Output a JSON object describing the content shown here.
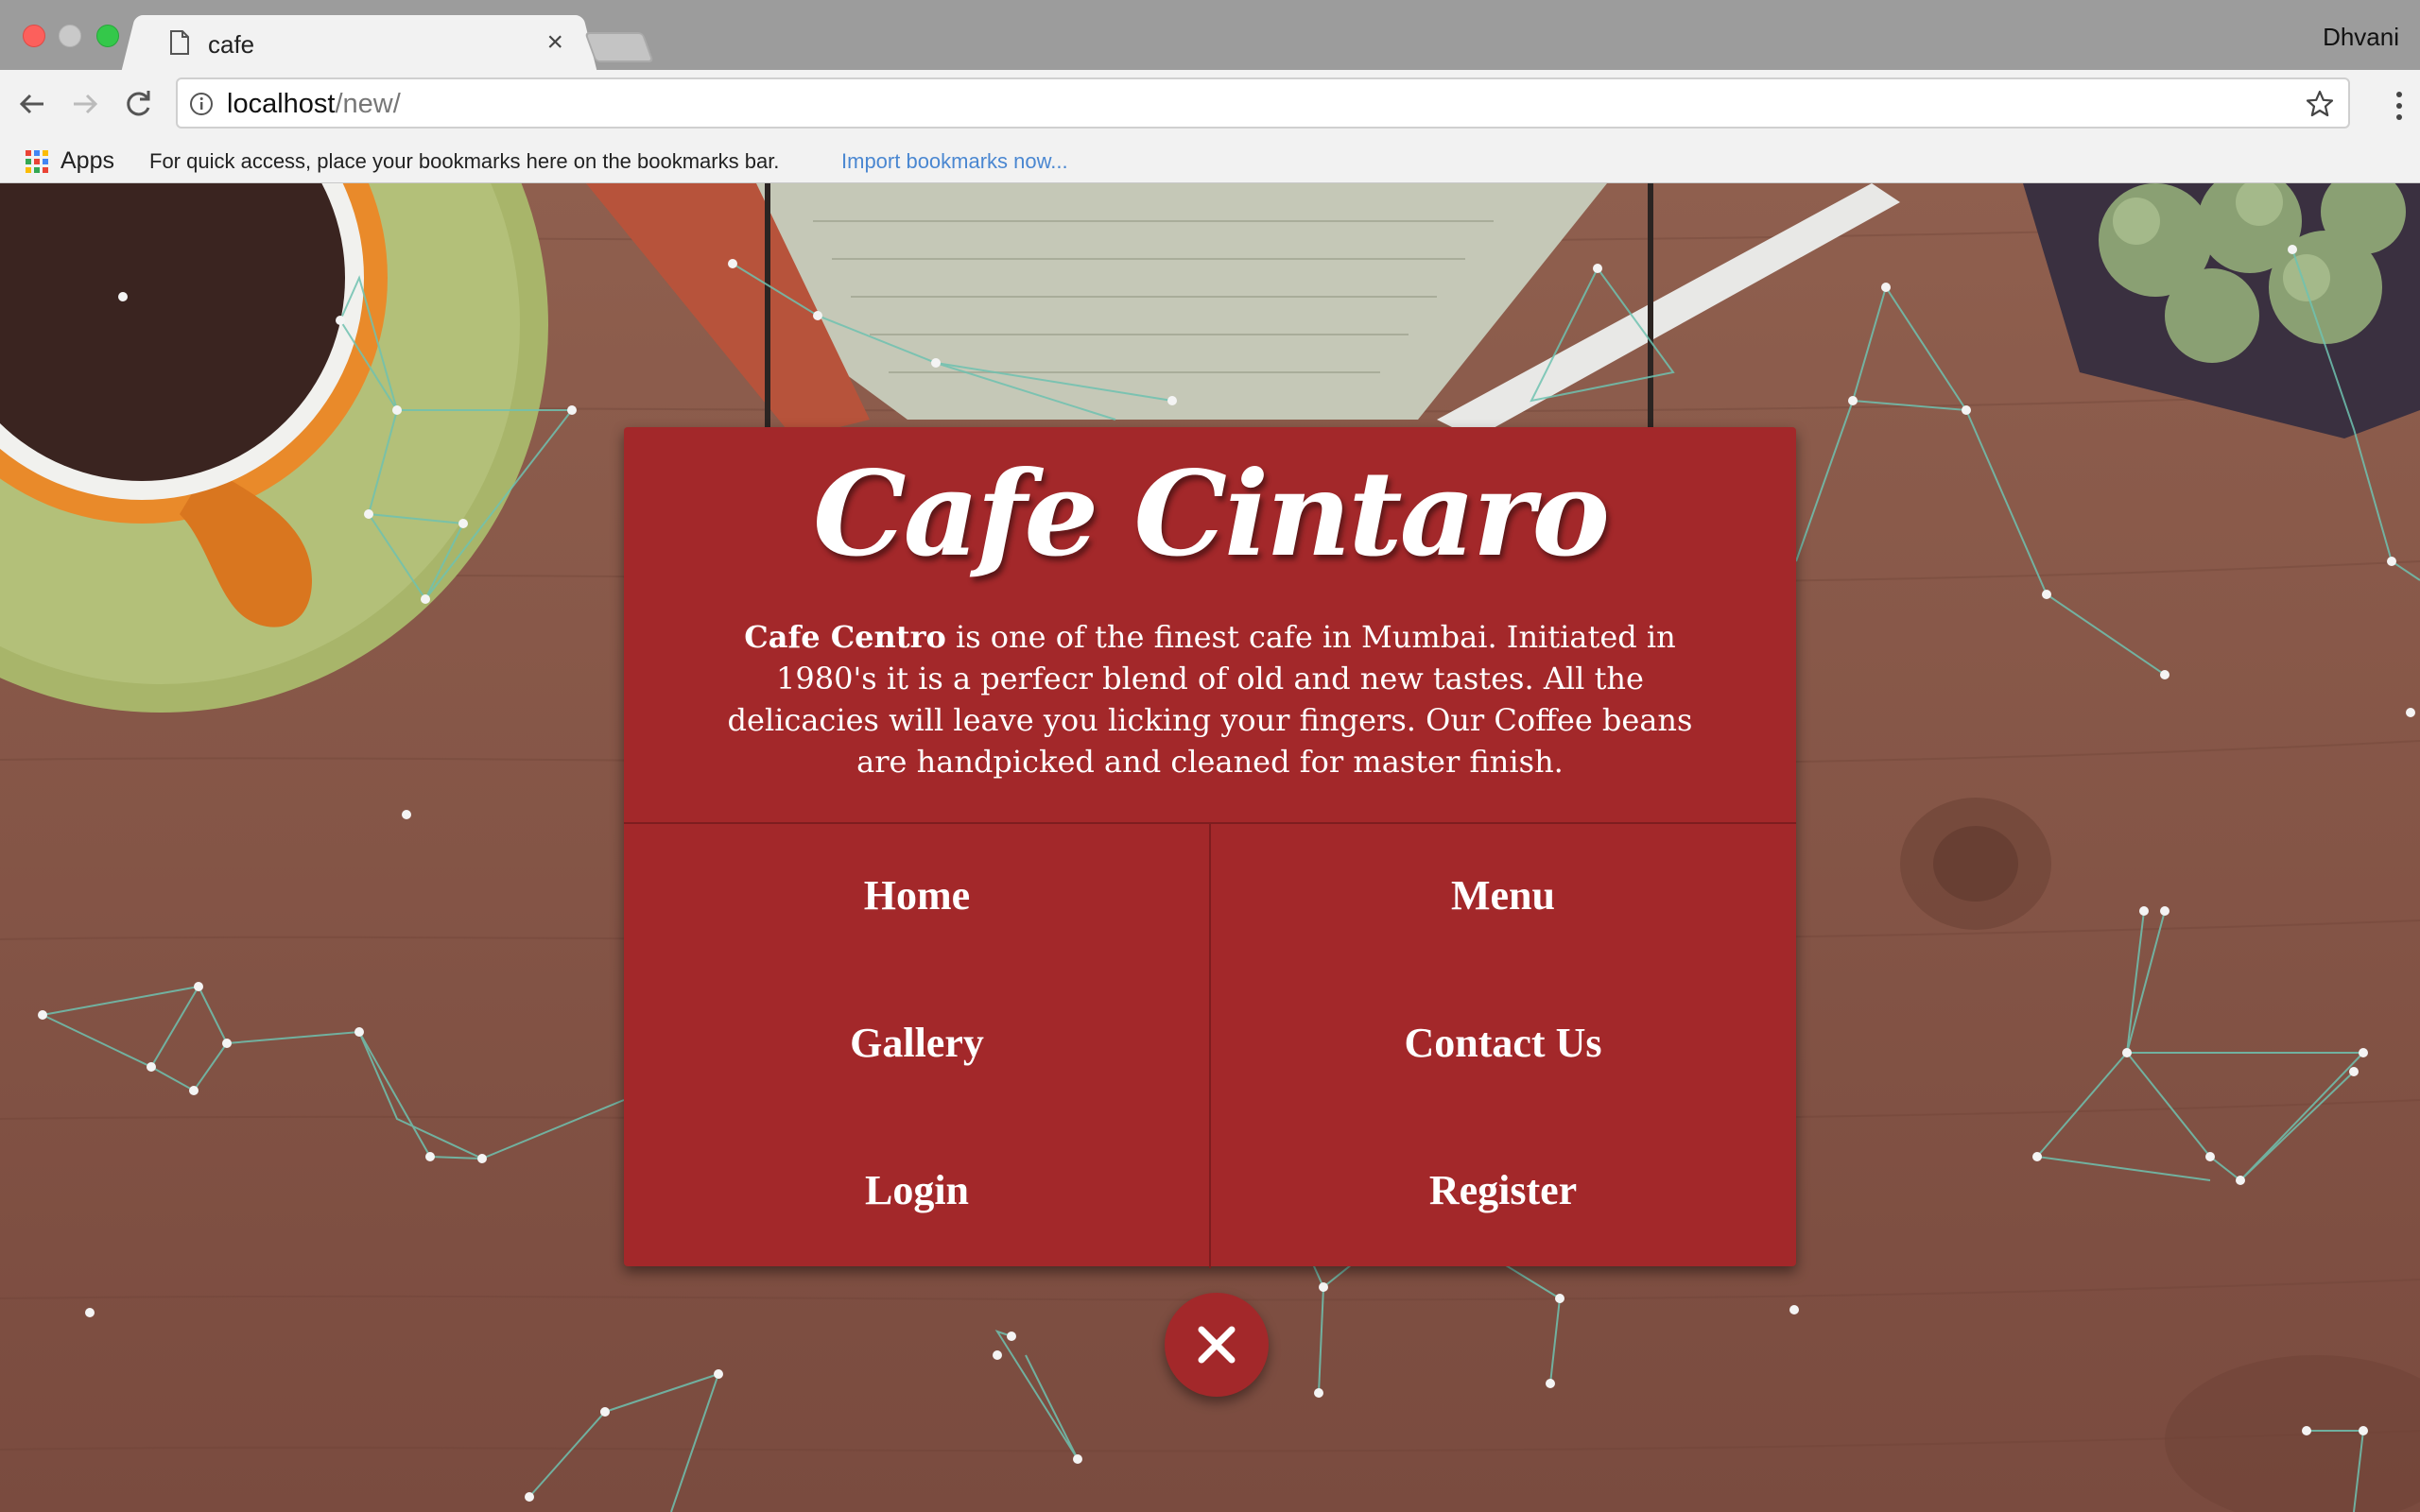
{
  "browser": {
    "tab_title": "cafe",
    "profile_name": "Dhvani",
    "url_host": "localhost",
    "url_path": "/new/",
    "bookmarks_bar": {
      "apps_label": "Apps",
      "hint": "For quick access, place your bookmarks here on the bookmarks bar.",
      "import_link": "Import bookmarks now..."
    }
  },
  "page": {
    "brand_title": "Cafe Cintaro",
    "description_bold": "Cafe Centro",
    "description_rest": " is one of the finest cafe in Mumbai. Initiated in 1980's it is a perfecr blend of old and new tastes. All the delicacies will leave you licking your fingers. Our Coffee beans are handpicked and cleaned for master finish.",
    "nav": {
      "home": "Home",
      "menu": "Menu",
      "gallery": "Gallery",
      "contact": "Contact Us",
      "login": "Login",
      "register": "Register"
    },
    "close_icon": "close-icon"
  },
  "colors": {
    "sign_red": "#a3282a",
    "network_line": "#6fc2b0",
    "link_blue": "#4a87d1"
  }
}
